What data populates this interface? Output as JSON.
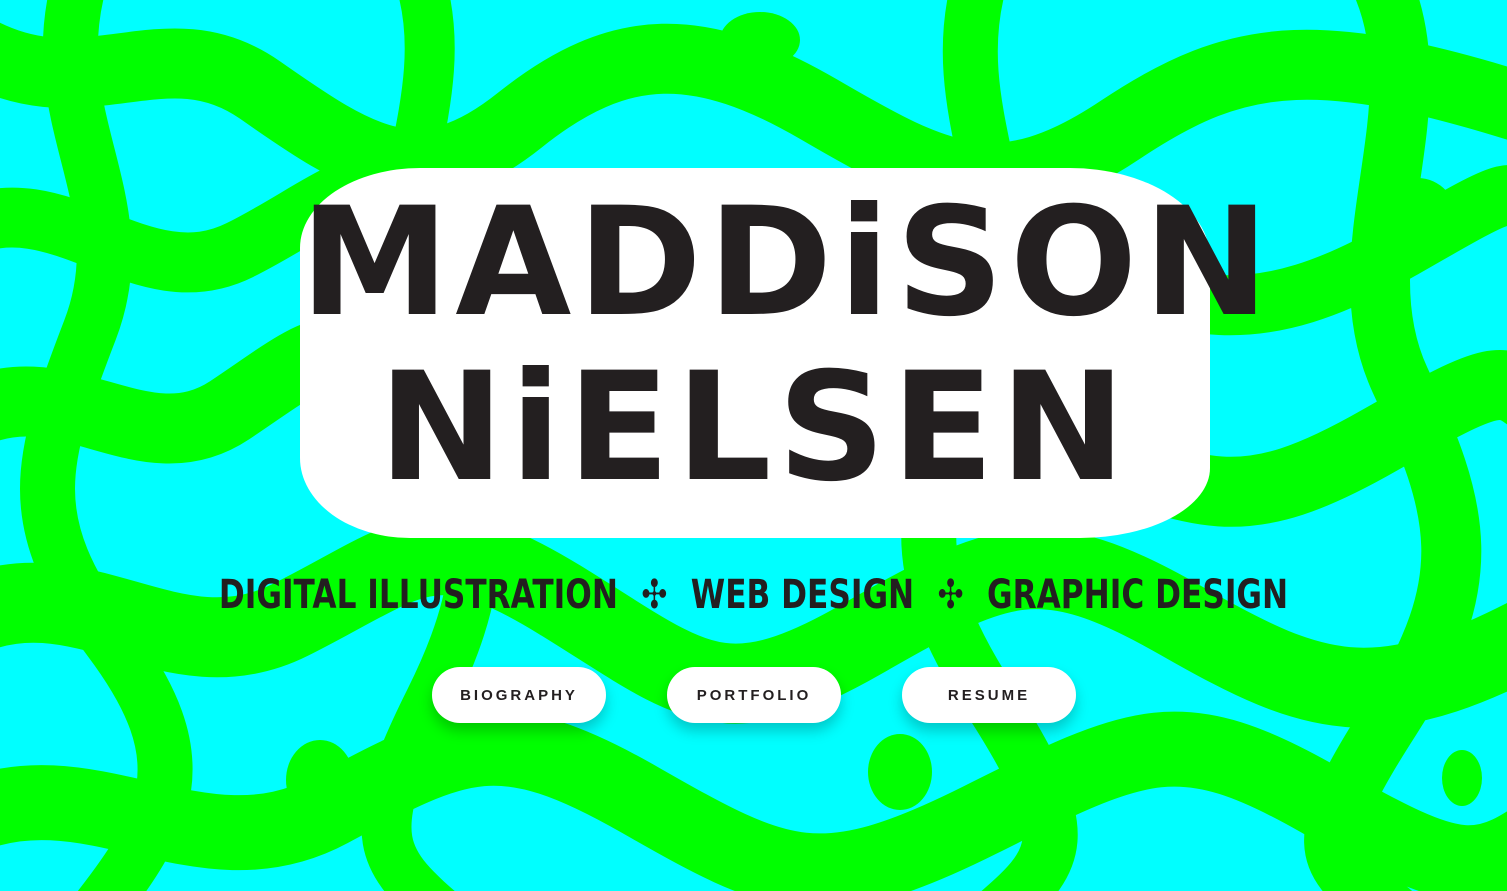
{
  "hero": {
    "name_line1": "MADDiSON",
    "name_line2": "NiELSEN",
    "tagline": {
      "item1": "DIGITAL ILLUSTRATION",
      "item2": "WEB DESIGN",
      "item3": "GRAPHIC DESIGN",
      "separator": "✣"
    }
  },
  "nav": {
    "biography": "BIOGRAPHY",
    "portfolio": "PORTFOLIO",
    "resume": "RESUME"
  },
  "colors": {
    "background_cyan": "#00FFFF",
    "swirl_green": "#00FF00",
    "ink": "#231F20",
    "button_bg": "#FFFFFF"
  }
}
